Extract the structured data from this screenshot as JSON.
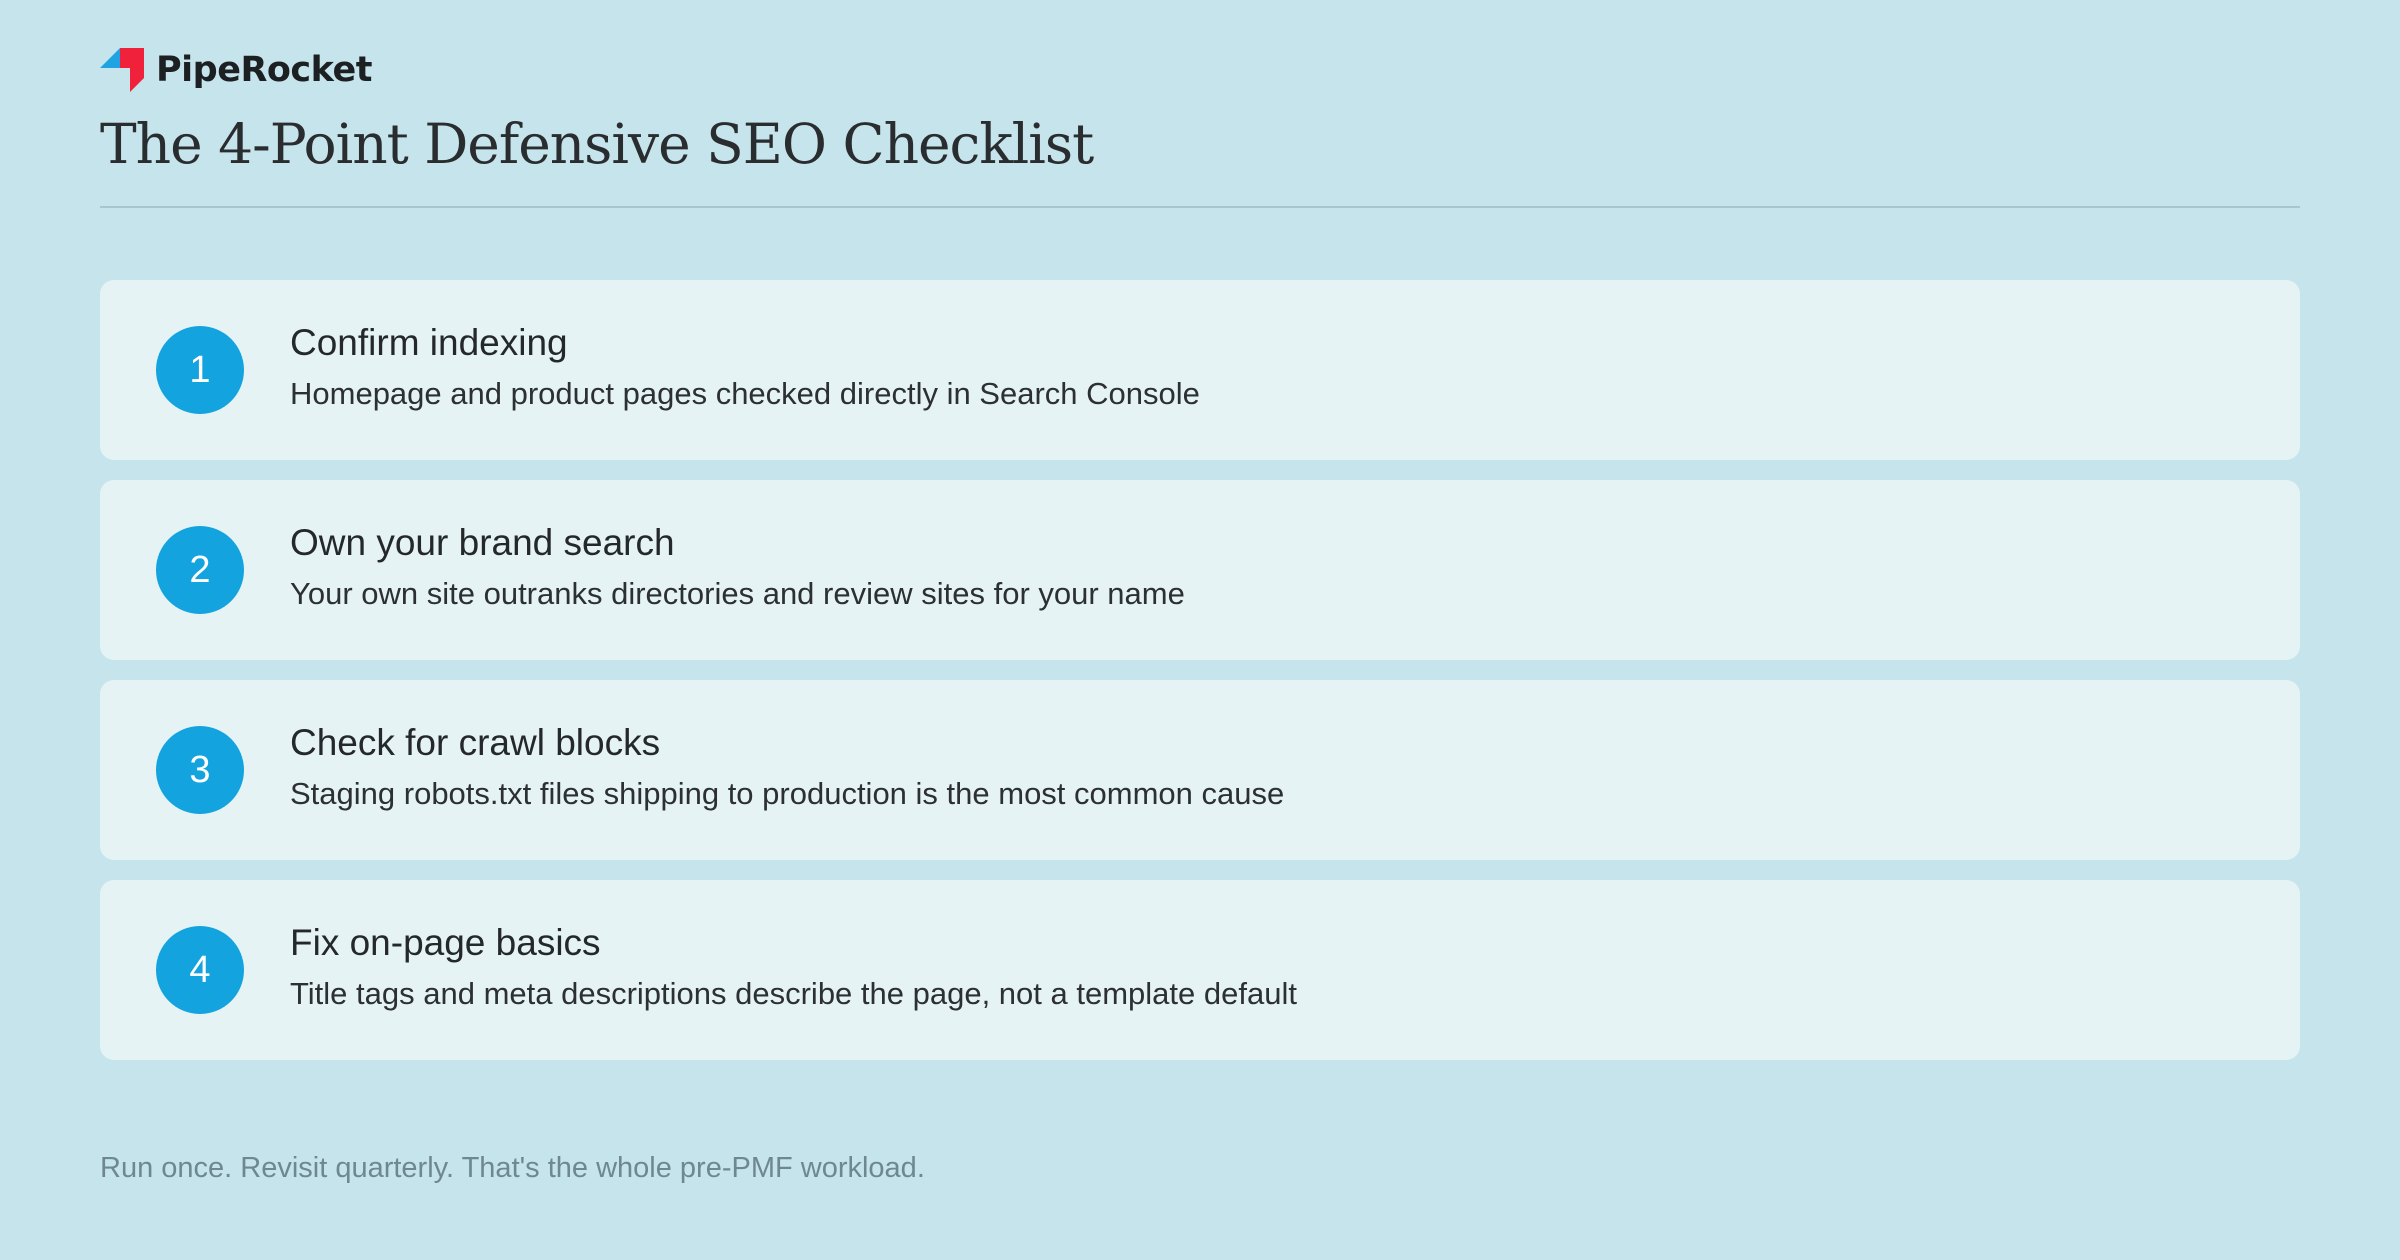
{
  "brand": {
    "name": "PipeRocket",
    "logo_icon": "piperocket-logo-icon",
    "colors": {
      "blue": "#1fa3e3",
      "red": "#f0213a"
    }
  },
  "page_title": "The 4-Point Defensive SEO Checklist",
  "accent_color": "#13a3de",
  "checklist": [
    {
      "number": "1",
      "title": "Confirm indexing",
      "description": "Homepage and product pages checked directly in Search Console"
    },
    {
      "number": "2",
      "title": "Own your brand search",
      "description": "Your own site outranks directories and review sites for your name"
    },
    {
      "number": "3",
      "title": "Check for crawl blocks",
      "description": "Staging robots.txt files shipping to production is the most common cause"
    },
    {
      "number": "4",
      "title": "Fix on-page basics",
      "description": "Title tags and meta descriptions describe the page, not a template default"
    }
  ],
  "footer_note": "Run once. Revisit quarterly. That's the whole pre-PMF workload."
}
